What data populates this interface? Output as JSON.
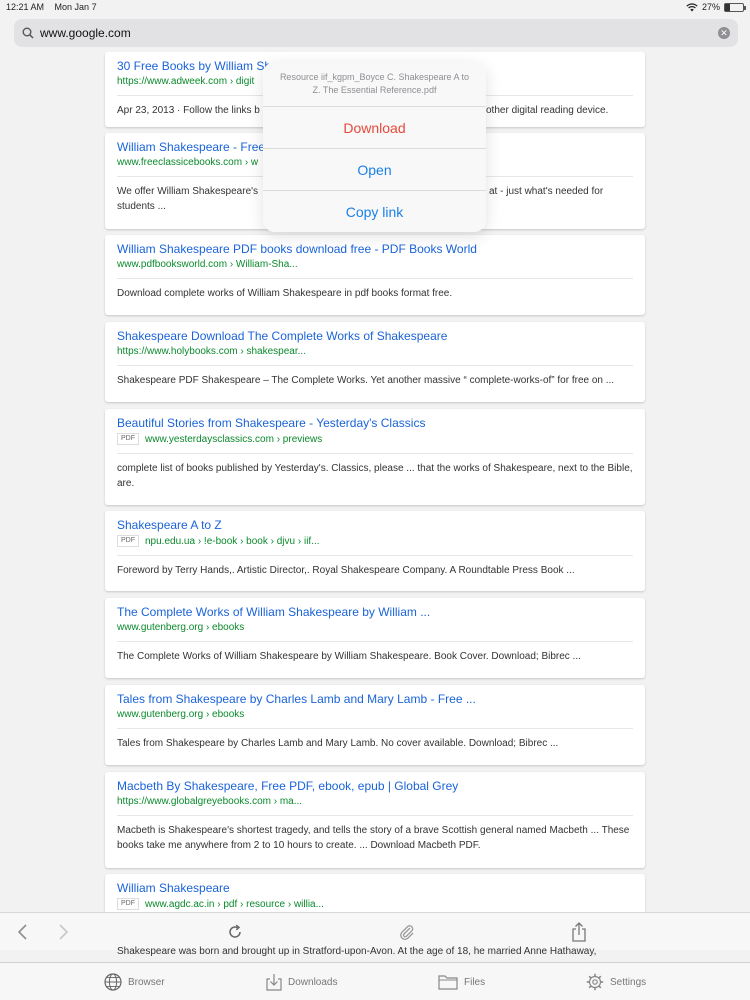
{
  "status_bar": {
    "time": "12:21 AM",
    "date": "Mon Jan 7",
    "battery": "27%",
    "battery_level": 0.27
  },
  "url_bar": {
    "value": "www.google.com"
  },
  "popover": {
    "title": "Resource iif_kgpm_Boyce C. Shakespeare A to Z. The Essential Reference.pdf",
    "actions": [
      "Download",
      "Open",
      "Copy link"
    ]
  },
  "results": [
    {
      "title": "30 Free Books by William Sh",
      "url": "https://www.adweek.com › digit",
      "pdf": false,
      "snippet": "Apr 23, 2013 · Follow the links b",
      "snippet_tail": "other digital reading device."
    },
    {
      "title": "William Shakespeare - Free",
      "url": "www.freeclassicebooks.com › w",
      "pdf": false,
      "snippet": "We offer William Shakespeare's",
      "snippet_tail": "at - just what's needed for",
      "snippet2": "students ..."
    },
    {
      "title": "William Shakespeare PDF books download free - PDF Books World",
      "url": "www.pdfbooksworld.com › William-Sha...",
      "pdf": false,
      "snippet": "Download complete works of William Shakespeare in pdf books format free."
    },
    {
      "title": "Shakespeare Download The Complete Works of Shakespeare",
      "url": "https://www.holybooks.com › shakespear...",
      "pdf": false,
      "snippet": "Shakespeare PDF Shakespeare – The Complete Works. Yet another massive “ complete-works-of” for free on ..."
    },
    {
      "title": "Beautiful Stories from Shakespeare - Yesterday's Classics",
      "url": "www.yesterdaysclassics.com › previews",
      "pdf": true,
      "snippet": "complete list of books published by Yesterday's. Classics, please ... that the works of Shakespeare, next to the Bible, are."
    },
    {
      "title": "Shakespeare A to Z",
      "url": "npu.edu.ua › !e-book › book › djvu › iif...",
      "pdf": true,
      "snippet": "Foreword by Terry Hands,. Artistic Director,. Royal Shakespeare Company. A Roundtable Press Book ..."
    },
    {
      "title": "The Complete Works of William Shakespeare by William ...",
      "url": "www.gutenberg.org › ebooks",
      "pdf": false,
      "snippet": "The Complete Works of William Shakespeare by William Shakespeare. Book Cover. Download; Bibrec ..."
    },
    {
      "title": "Tales from Shakespeare by Charles Lamb and Mary Lamb - Free ...",
      "url": "www.gutenberg.org › ebooks",
      "pdf": false,
      "snippet": "Tales from Shakespeare by Charles Lamb and Mary Lamb. No cover available. Download; Bibrec ..."
    },
    {
      "title": "Macbeth By Shakespeare, Free PDF, ebook, epub | Global Grey",
      "url": "https://www.globalgreyebooks.com › ma...",
      "pdf": false,
      "snippet": "Macbeth is Shakespeare's shortest tragedy, and tells the story of a brave Scottish general named Macbeth ... These books take me anywhere from 2 to 10 hours to create. ... Download Macbeth PDF."
    },
    {
      "title": "William Shakespeare",
      "url": "www.agdc.ac.in › pdf › resource › willia...",
      "pdf": true,
      "snippet": ""
    }
  ],
  "peek_snippet": "Shakespeare was born and brought up in Stratford-upon-Avon. At the age of 18, he married Anne Hathaway,",
  "pdf_label": "PDF",
  "tabs": [
    "Browser",
    "Downloads",
    "Files",
    "Settings"
  ],
  "colors": {
    "link": "#1a63d8",
    "url": "#0b8a2c",
    "destructive": "#e8483a",
    "action": "#1a80e8"
  }
}
